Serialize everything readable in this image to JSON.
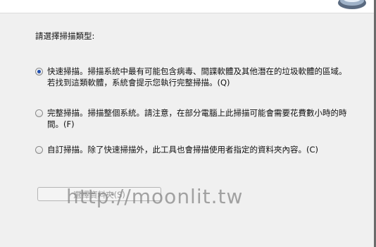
{
  "prompt": "請選擇掃描類型:",
  "options": [
    {
      "text": "快速掃描。掃描系統中最有可能包含病毒、間諜軟體及其他潛在的垃圾軟體的區域。若找到這類軟體，系統會提示您執行完整掃描。(Q)",
      "checked": true
    },
    {
      "text": "完整掃描。掃描整個系統。請注意，在部分電腦上此掃描可能會需要花費數小時的時間。(F)",
      "checked": false
    },
    {
      "text": "自訂掃描。除了快速掃描外，此工具也會掃描使用者指定的資料夾內容。(C)",
      "checked": false
    }
  ],
  "select_button_label": "選擇資料夾(S)",
  "watermark": "http://moonlit.tw",
  "icons": {
    "top_right": "scanner-app-icon"
  }
}
